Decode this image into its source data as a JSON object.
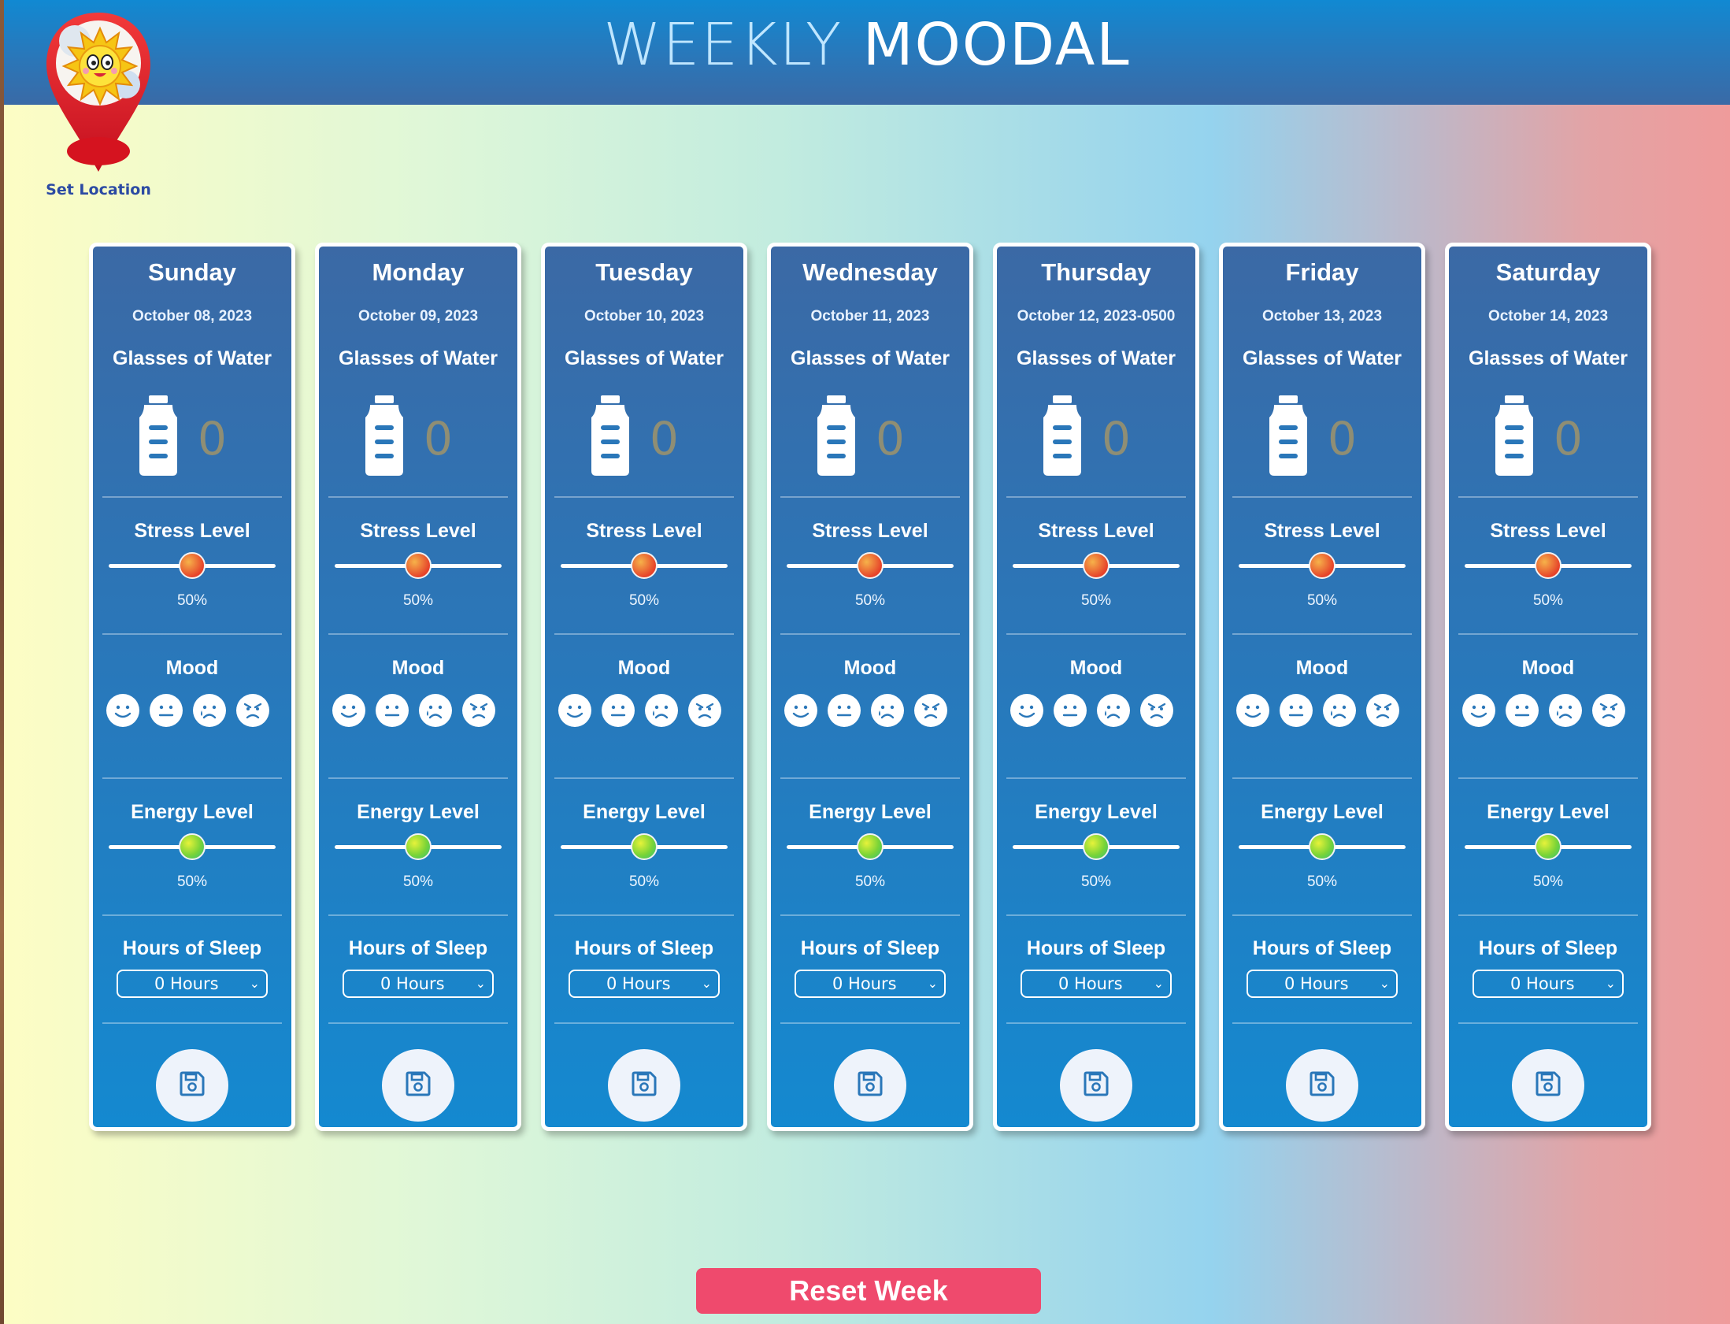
{
  "app": {
    "title_light": "WEEKLY",
    "title_bold": "MOODAL"
  },
  "location": {
    "label": "Set Location",
    "icon": "sun-location-pin-icon"
  },
  "labels": {
    "water": "Glasses of Water",
    "stress": "Stress Level",
    "mood": "Mood",
    "energy": "Energy Level",
    "sleep": "Hours of Sleep"
  },
  "mood_icons": [
    "happy-face-icon",
    "neutral-face-icon",
    "sad-face-icon",
    "angry-face-icon"
  ],
  "days": [
    {
      "name": "Sunday",
      "date": "October 08, 2023",
      "water": "0",
      "stress": "50%",
      "stress_value": 50,
      "energy": "50%",
      "energy_value": 50,
      "sleep": "0 Hours"
    },
    {
      "name": "Monday",
      "date": "October 09, 2023",
      "water": "0",
      "stress": "50%",
      "stress_value": 50,
      "energy": "50%",
      "energy_value": 50,
      "sleep": "0 Hours"
    },
    {
      "name": "Tuesday",
      "date": "October 10, 2023",
      "water": "0",
      "stress": "50%",
      "stress_value": 50,
      "energy": "50%",
      "energy_value": 50,
      "sleep": "0 Hours"
    },
    {
      "name": "Wednesday",
      "date": "October 11, 2023",
      "water": "0",
      "stress": "50%",
      "stress_value": 50,
      "energy": "50%",
      "energy_value": 50,
      "sleep": "0 Hours"
    },
    {
      "name": "Thursday",
      "date": "October 12, 2023-0500",
      "water": "0",
      "stress": "50%",
      "stress_value": 50,
      "energy": "50%",
      "energy_value": 50,
      "sleep": "0 Hours"
    },
    {
      "name": "Friday",
      "date": "October 13, 2023",
      "water": "0",
      "stress": "50%",
      "stress_value": 50,
      "energy": "50%",
      "energy_value": 50,
      "sleep": "0 Hours"
    },
    {
      "name": "Saturday",
      "date": "October 14, 2023",
      "water": "0",
      "stress": "50%",
      "stress_value": 50,
      "energy": "50%",
      "energy_value": 50,
      "sleep": "0 Hours"
    }
  ],
  "reset": {
    "label": "Reset Week"
  },
  "colors": {
    "header": "#2a77b9",
    "reset": "#ef4a6d",
    "card_border": "#ffffff"
  }
}
